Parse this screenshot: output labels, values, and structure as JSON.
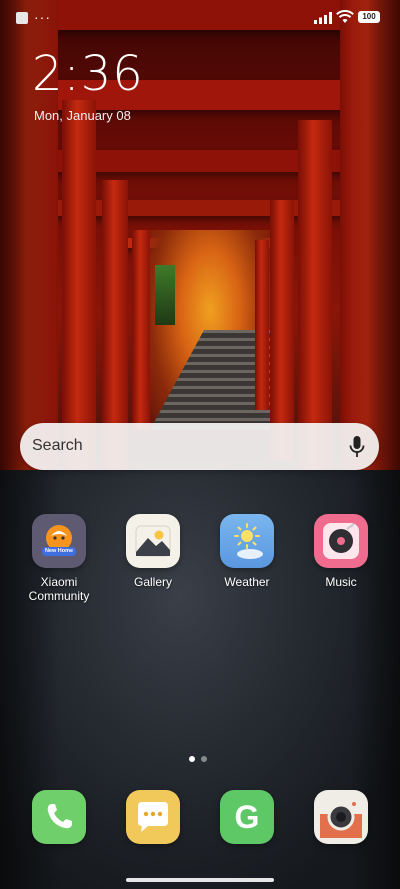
{
  "status_bar": {
    "battery": "100",
    "more_glyph": "···",
    "icons": [
      "notification-square-icon",
      "signal-icon",
      "wifi-icon",
      "battery-icon"
    ]
  },
  "clock": {
    "time": "2:36",
    "date": "Mon, January 08"
  },
  "search": {
    "placeholder": "Search",
    "icon": "microphone-icon"
  },
  "apps": [
    {
      "label_line1": "Xiaomi",
      "label_line2": "Community",
      "icon": "xiaomi-community-icon",
      "badge_text": "New Home",
      "color": "#5e5a72"
    },
    {
      "label_line1": "Gallery",
      "icon": "gallery-icon",
      "color": "#f4f1e8"
    },
    {
      "label_line1": "Weather",
      "icon": "weather-icon",
      "color": "#6aa6e8"
    },
    {
      "label_line1": "Music",
      "icon": "music-icon",
      "color": "#f06c8e"
    }
  ],
  "dock": [
    {
      "icon": "phone-icon",
      "color": "#6fcf6a"
    },
    {
      "icon": "messages-icon",
      "color": "#f1c95b"
    },
    {
      "icon": "g-app-icon",
      "color": "#5ec766",
      "glyph": "G"
    },
    {
      "icon": "camera-icon",
      "color": "#f0ede6"
    }
  ],
  "pager": {
    "pages": 2,
    "active": 1
  }
}
